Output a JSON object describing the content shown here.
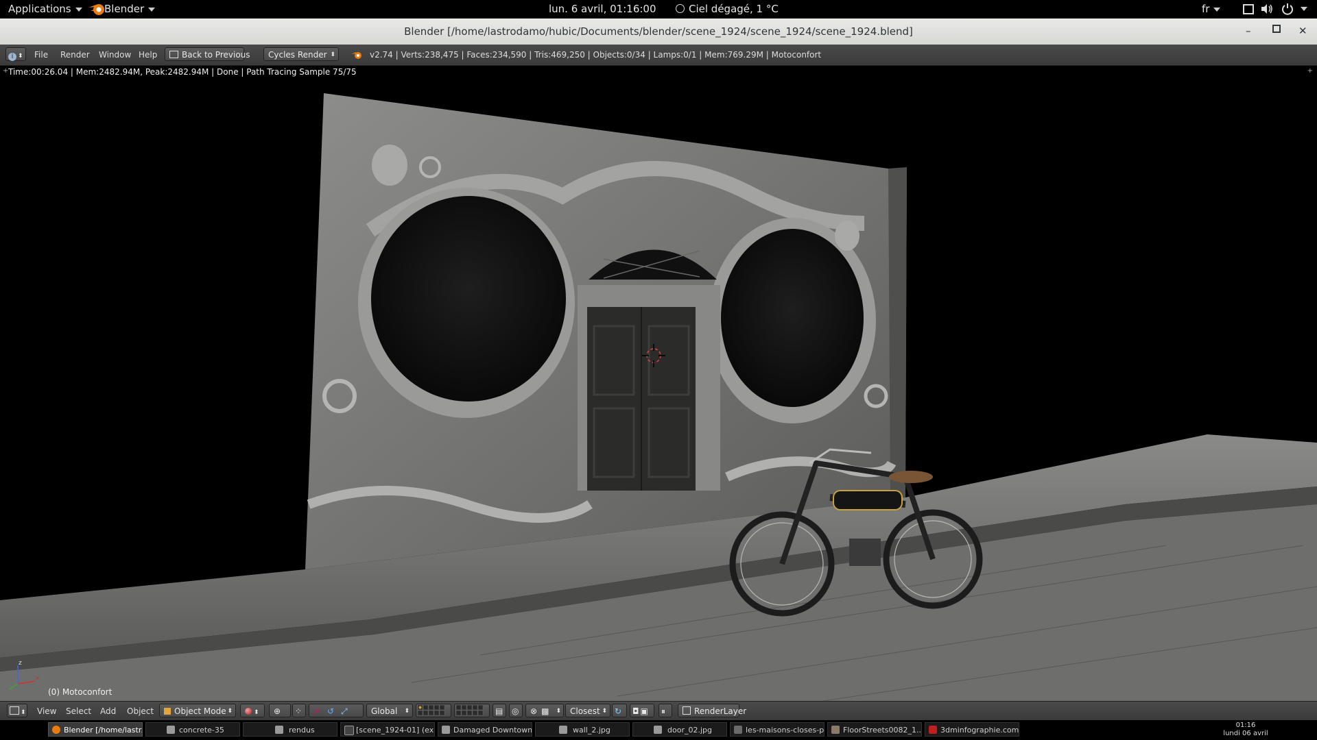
{
  "topbar": {
    "applications": "Applications",
    "app_name": "Blender",
    "datetime": "lun.  6 avril, 01:16:00",
    "weather": "Ciel dégagé, 1 °C",
    "language": "fr"
  },
  "window": {
    "title": "Blender [/home/lastrodamo/hubic/Documents/blender/scene_1924/scene_1924/scene_1924.blend]"
  },
  "info_header": {
    "menu": [
      "File",
      "Render",
      "Window",
      "Help"
    ],
    "back_button": "Back to Previous",
    "render_engine": "Cycles Render",
    "stats": "v2.74 | Verts:238,475 | Faces:234,590 | Tris:469,250 | Objects:0/34 | Lamps:0/1 | Mem:769.29M | Motoconfort"
  },
  "viewport": {
    "render_status": "Time:00:26.04 | Mem:2482.94M, Peak:2482.94M | Done | Path Tracing Sample 75/75",
    "object_label": "(0) Motoconfort"
  },
  "view_header": {
    "menu": [
      "View",
      "Select",
      "Add",
      "Object"
    ],
    "mode": "Object Mode",
    "orientation": "Global",
    "snap_target": "Closest",
    "render_layer": "RenderLayer"
  },
  "taskbar": {
    "tasks": [
      "Blender [/home/lastr...",
      "concrete-35",
      "rendus",
      "[scene_1924-01] (ex...",
      "Damaged Downtown",
      "wall_2.jpg",
      "door_02.jpg",
      "les-maisons-closes-p...",
      "FloorStreets0082_1...",
      "3dminfographie.com..."
    ],
    "clock_time": "01:16",
    "clock_date": "lundi 06 avril"
  },
  "colors": {
    "accent_orange": "#e87d0d",
    "filezilla_red": "#bf1f1f",
    "header_bg": "#444444"
  }
}
